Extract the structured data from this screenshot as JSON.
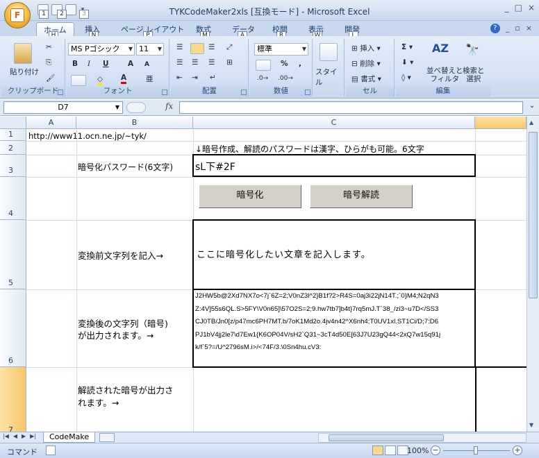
{
  "window": {
    "title": "TYKCodeMaker2xls [互換モード] - Microsoft Excel",
    "controls": [
      "_",
      "□",
      "×"
    ]
  },
  "key_tips": {
    "qat1": "1",
    "qat2": "2",
    "qat3": "3",
    "office": "F"
  },
  "ribbon_tabs": [
    {
      "label": "ホーム",
      "key": "H"
    },
    {
      "label": "挿入",
      "key": "N"
    },
    {
      "label": "ページ レイアウト",
      "key": "P"
    },
    {
      "label": "数式",
      "key": "M"
    },
    {
      "label": "データ",
      "key": "A"
    },
    {
      "label": "校閲",
      "key": "R"
    },
    {
      "label": "表示",
      "key": "W"
    },
    {
      "label": "開発",
      "key": "L"
    }
  ],
  "ribbon": {
    "clipboard": {
      "label": "クリップボード",
      "paste": "貼り付け"
    },
    "font": {
      "label": "フォント",
      "name": "MS Pゴシック",
      "size": "11",
      "bold": "B",
      "italic": "I",
      "underline": "U",
      "grow": "A",
      "shrink": "A"
    },
    "alignment": {
      "label": "配置"
    },
    "number": {
      "label": "数値",
      "format": "標準",
      "percent": "%",
      "comma": ","
    },
    "style": {
      "label": "スタイル"
    },
    "cells": {
      "label": "セル",
      "insert": "挿入",
      "delete": "削除",
      "format": "書式"
    },
    "editing": {
      "label": "編集",
      "sum": "Σ",
      "sort_filter": "並べ替えと\nフィルタ",
      "find_select": "検索と\n選択"
    }
  },
  "formula_bar": {
    "name_box": "D7",
    "fx": "fx",
    "content": ""
  },
  "columns": [
    "A",
    "B",
    "C"
  ],
  "rows": [
    "1",
    "2",
    "3",
    "4",
    "5",
    "6",
    "7"
  ],
  "cells": {
    "a1": "http://www11.ocn.ne.jp/~tyk/",
    "c2": "↓暗号作成、解読のパスワードは漢字、ひらがも可能。6文字",
    "b3": "暗号化パスワード(6文字)",
    "c3": "sL下#2F",
    "b5": "変換前文字列を記入→",
    "c5": "ここに暗号化したい文章を記入します。",
    "b6_line1": "変換後の文字列（暗号)",
    "b6_line2": "が出力されます。→",
    "c6": "J2HW5b@2Xd7NX7o<7j`6Z=2;V0nZ3l^2}B1f?2>R4S=0aj3i22jN14T.;`0}M4;N2qN3\nZ:4V]55s6QL.S>5FY\\V0n65]\\57O2S=2;9.hw7tb7]b4t}7rq5mJ.T`38_/zi3~u7D</SS3\nCJ0TB/Jn0[z/p47mc6PH7MT.b/7oK1Md2o.4jv4n42^X6nh4;T0UV1xl.ST1Ci/D;7:D6\nPJ1bV4jj2le7\\d7Ew1{K6OP04V/sH2`Q31~3cT4d50E[63J7U23gQ44<2xQ7w15q91j\nk/f`5?=/U^2796sM.i>/<74F/3.\\0Sn4hu.cV3:",
    "b7_line1": "解読された暗号が出力さ",
    "b7_line2": "れます。→"
  },
  "buttons": {
    "encrypt": "暗号化",
    "decrypt": "暗号解読"
  },
  "sheet_tabs": [
    "CodeMake"
  ],
  "status": {
    "mode": "コマンド",
    "zoom": "100%"
  }
}
